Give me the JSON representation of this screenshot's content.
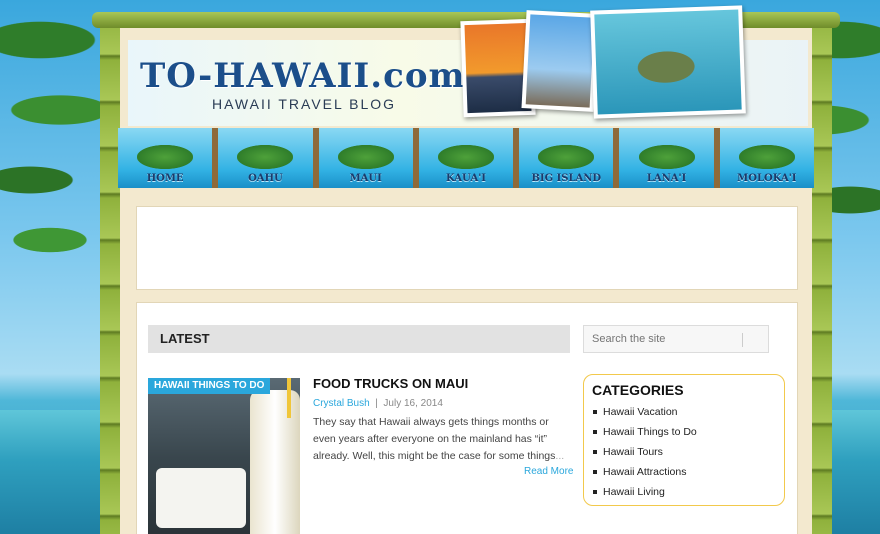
{
  "site": {
    "logo_text": "TO-HAWAII.com",
    "tagline": "HAWAII TRAVEL BLOG"
  },
  "nav": {
    "items": [
      {
        "label": "HOME"
      },
      {
        "label": "OAHU"
      },
      {
        "label": "MAUI"
      },
      {
        "label": "KAUA'I"
      },
      {
        "label": "BIG ISLAND"
      },
      {
        "label": "LANA'I"
      },
      {
        "label": "MOLOKA'I"
      }
    ]
  },
  "main": {
    "section_title": "LATEST"
  },
  "search": {
    "placeholder": "Search the site"
  },
  "post": {
    "category_badge": "HAWAII THINGS TO DO",
    "title": "FOOD TRUCKS ON MAUI",
    "author": "Crystal Bush",
    "separator": "|",
    "date": "July 16, 2014",
    "excerpt": "They say that Hawaii always gets things months or even years after everyone on the mainland has “it” already. Well, this might be the case for some things",
    "ellipsis": "...",
    "read_more": "Read More"
  },
  "sidebar": {
    "categories_title": "CATEGORIES",
    "categories": [
      {
        "label": "Hawaii Vacation"
      },
      {
        "label": "Hawaii Things to Do"
      },
      {
        "label": "Hawaii Tours"
      },
      {
        "label": "Hawaii Attractions"
      },
      {
        "label": "Hawaii Living"
      }
    ]
  }
}
